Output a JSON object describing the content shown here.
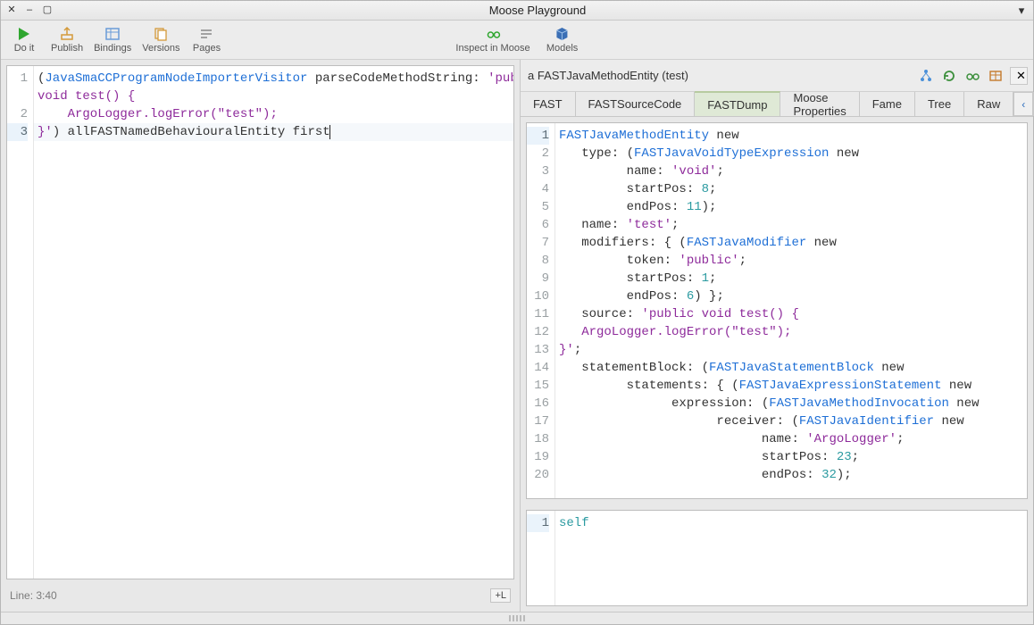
{
  "window": {
    "title": "Moose Playground"
  },
  "toolbar": {
    "doit": "Do it",
    "publish": "Publish",
    "bindings": "Bindings",
    "versions": "Versions",
    "pages": "Pages",
    "inspect": "Inspect in Moose",
    "models": "Models"
  },
  "left": {
    "code_lines": [
      [
        {
          "t": "(",
          "c": "tok-plain"
        },
        {
          "t": "JavaSmaCCProgramNodeImporterVisitor",
          "c": "tok-blue"
        },
        {
          "t": " parseCodeMethodString: ",
          "c": "tok-plain"
        },
        {
          "t": "'public ",
          "c": "tok-purp"
        }
      ],
      [
        {
          "t": "void test() {",
          "c": "tok-purp"
        }
      ],
      [
        {
          "t": "    ArgoLogger.logError(\"test\");",
          "c": "tok-purp"
        }
      ],
      [
        {
          "t": "}'",
          "c": "tok-purp"
        },
        {
          "t": ") allFASTNamedBehaviouralEntity first",
          "c": "tok-plain"
        }
      ]
    ],
    "line_numbers": [
      "1",
      "2",
      "3"
    ],
    "cursor_line_index": 2,
    "status": "Line: 3:40",
    "plusL": "+L"
  },
  "right": {
    "header_label": "a FASTJavaMethodEntity (test)",
    "tabs": [
      "FAST",
      "FASTSourceCode",
      "FASTDump",
      "Moose Properties",
      "Fame",
      "Tree",
      "Raw"
    ],
    "active_tab": 2,
    "top_lines": [
      [
        {
          "t": "FASTJavaMethodEntity",
          "c": "tok-blue"
        },
        {
          "t": " new",
          "c": "tok-plain"
        }
      ],
      [
        {
          "t": "   type: (",
          "c": "tok-plain"
        },
        {
          "t": "FASTJavaVoidTypeExpression",
          "c": "tok-blue"
        },
        {
          "t": " new",
          "c": "tok-plain"
        }
      ],
      [
        {
          "t": "         name: ",
          "c": "tok-plain"
        },
        {
          "t": "'void'",
          "c": "tok-purp"
        },
        {
          "t": ";",
          "c": "tok-plain"
        }
      ],
      [
        {
          "t": "         startPos: ",
          "c": "tok-plain"
        },
        {
          "t": "8",
          "c": "tok-teal"
        },
        {
          "t": ";",
          "c": "tok-plain"
        }
      ],
      [
        {
          "t": "         endPos: ",
          "c": "tok-plain"
        },
        {
          "t": "11",
          "c": "tok-teal"
        },
        {
          "t": ");",
          "c": "tok-plain"
        }
      ],
      [
        {
          "t": "   name: ",
          "c": "tok-plain"
        },
        {
          "t": "'test'",
          "c": "tok-purp"
        },
        {
          "t": ";",
          "c": "tok-plain"
        }
      ],
      [
        {
          "t": "   modifiers: { (",
          "c": "tok-plain"
        },
        {
          "t": "FASTJavaModifier",
          "c": "tok-blue"
        },
        {
          "t": " new",
          "c": "tok-plain"
        }
      ],
      [
        {
          "t": "         token: ",
          "c": "tok-plain"
        },
        {
          "t": "'public'",
          "c": "tok-purp"
        },
        {
          "t": ";",
          "c": "tok-plain"
        }
      ],
      [
        {
          "t": "         startPos: ",
          "c": "tok-plain"
        },
        {
          "t": "1",
          "c": "tok-teal"
        },
        {
          "t": ";",
          "c": "tok-plain"
        }
      ],
      [
        {
          "t": "         endPos: ",
          "c": "tok-plain"
        },
        {
          "t": "6",
          "c": "tok-teal"
        },
        {
          "t": ") };",
          "c": "tok-plain"
        }
      ],
      [
        {
          "t": "   source: ",
          "c": "tok-plain"
        },
        {
          "t": "'public void test() {",
          "c": "tok-purp"
        }
      ],
      [
        {
          "t": "   ArgoLogger.logError(\"test\");",
          "c": "tok-purp"
        }
      ],
      [
        {
          "t": "}'",
          "c": "tok-purp"
        },
        {
          "t": ";",
          "c": "tok-plain"
        }
      ],
      [
        {
          "t": "   statementBlock: (",
          "c": "tok-plain"
        },
        {
          "t": "FASTJavaStatementBlock",
          "c": "tok-blue"
        },
        {
          "t": " new",
          "c": "tok-plain"
        }
      ],
      [
        {
          "t": "         statements: { (",
          "c": "tok-plain"
        },
        {
          "t": "FASTJavaExpressionStatement",
          "c": "tok-blue"
        },
        {
          "t": " new",
          "c": "tok-plain"
        }
      ],
      [
        {
          "t": "               expression: (",
          "c": "tok-plain"
        },
        {
          "t": "FASTJavaMethodInvocation",
          "c": "tok-blue"
        },
        {
          "t": " new",
          "c": "tok-plain"
        }
      ],
      [
        {
          "t": "                     receiver: (",
          "c": "tok-plain"
        },
        {
          "t": "FASTJavaIdentifier",
          "c": "tok-blue"
        },
        {
          "t": " new",
          "c": "tok-plain"
        }
      ],
      [
        {
          "t": "                           name: ",
          "c": "tok-plain"
        },
        {
          "t": "'ArgoLogger'",
          "c": "tok-purp"
        },
        {
          "t": ";",
          "c": "tok-plain"
        }
      ],
      [
        {
          "t": "                           startPos: ",
          "c": "tok-plain"
        },
        {
          "t": "23",
          "c": "tok-teal"
        },
        {
          "t": ";",
          "c": "tok-plain"
        }
      ],
      [
        {
          "t": "                           endPos: ",
          "c": "tok-plain"
        },
        {
          "t": "32",
          "c": "tok-teal"
        },
        {
          "t": ");",
          "c": "tok-plain"
        }
      ]
    ],
    "bottom_lines": [
      [
        {
          "t": "self",
          "c": "tok-teal"
        }
      ]
    ]
  }
}
